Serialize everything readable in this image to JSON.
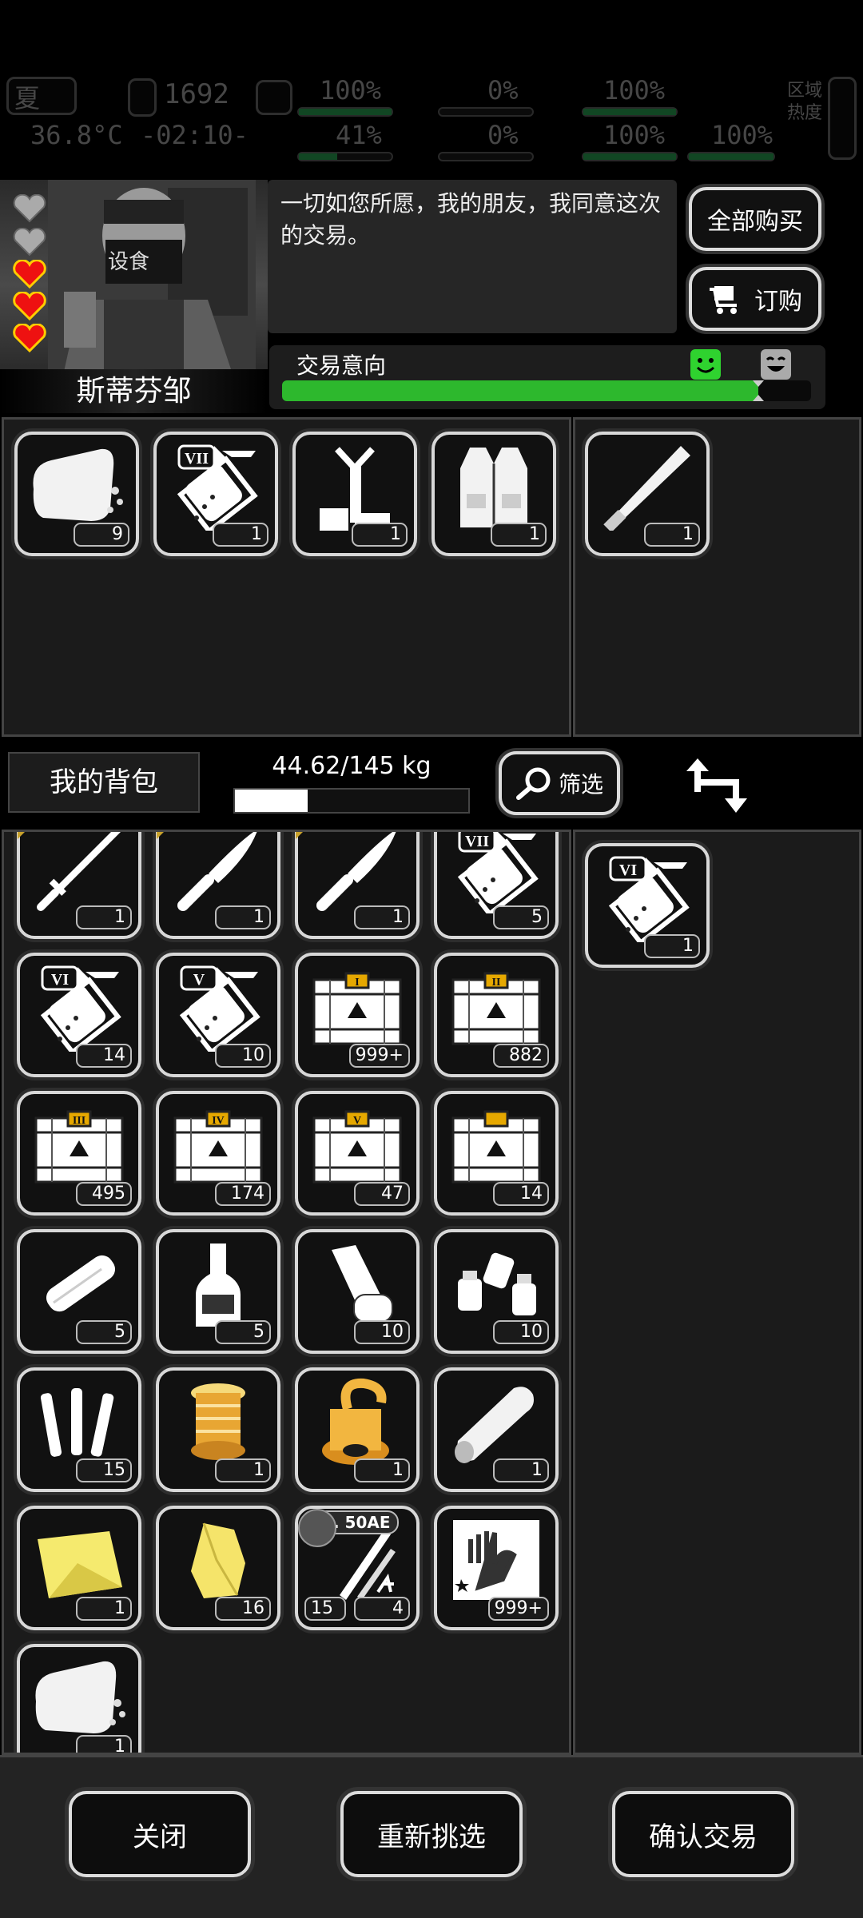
{
  "hud": {
    "season": "夏",
    "body_temp": "36.8°C",
    "day": "1692",
    "clock": "-02:10-",
    "health_pct": "100%",
    "sanity_pct": "41%",
    "blood_loss_pct": "0%",
    "bleed_pct": "0%",
    "stamina_pct": "100%",
    "heart_pct": "100%",
    "water_pct": "100%",
    "area_heat_label": "区域 热度"
  },
  "trader": {
    "name": "斯蒂芬邹",
    "mask_text": "设食",
    "hearts_filled": 3,
    "hearts_total": 5,
    "dialog": "一切如您所愿，我的朋友，我同意这次的交易。",
    "buy_all_label": "全部购买",
    "order_label": "订购",
    "intent_label": "交易意向",
    "intent_level": 0.9
  },
  "trader_inventory": [
    {
      "icon": "bread-icon",
      "count": "9"
    },
    {
      "icon": "potion-vii-icon",
      "count": "1",
      "tier": "VII"
    },
    {
      "icon": "tripod-icon",
      "count": "1"
    },
    {
      "icon": "vest-icon",
      "count": "1"
    },
    {
      "icon": "bat-icon",
      "count": "1"
    }
  ],
  "inventory_bar": {
    "title": "我的背包",
    "weight": "44.62/145 kg",
    "weight_fraction": 0.31,
    "filter_label": "筛选"
  },
  "my_items": [
    {
      "icon": "katana-icon",
      "count": "1",
      "marked": true
    },
    {
      "icon": "knife-icon",
      "count": "1",
      "marked": true
    },
    {
      "icon": "knife-icon",
      "count": "1",
      "marked": true
    },
    {
      "icon": "potion-vii-icon",
      "count": "5",
      "tier": "VII"
    },
    {
      "icon": "potion-vi-icon",
      "count": "14",
      "tier": "VI"
    },
    {
      "icon": "potion-v-icon",
      "count": "10",
      "tier": "V"
    },
    {
      "icon": "crate-i-icon",
      "count": "999+",
      "tier": "I"
    },
    {
      "icon": "crate-ii-icon",
      "count": "882",
      "tier": "II"
    },
    {
      "icon": "crate-iii-icon",
      "count": "495",
      "tier": "III"
    },
    {
      "icon": "crate-iv-icon",
      "count": "174",
      "tier": "IV"
    },
    {
      "icon": "crate-v-icon",
      "count": "47",
      "tier": "V"
    },
    {
      "icon": "crate-special-icon",
      "count": "14"
    },
    {
      "icon": "bandage-roll-icon",
      "count": "5"
    },
    {
      "icon": "bottle-icon",
      "count": "5"
    },
    {
      "icon": "paper-roll-icon",
      "count": "10"
    },
    {
      "icon": "bottles-icon",
      "count": "10"
    },
    {
      "icon": "tubes-icon",
      "count": "15"
    },
    {
      "icon": "gold-spool-icon",
      "count": "1"
    },
    {
      "icon": "gold-fitting-icon",
      "count": "1"
    },
    {
      "icon": "log-icon",
      "count": "1"
    },
    {
      "icon": "gold-cloth-icon",
      "count": "1"
    },
    {
      "icon": "gold-ore-icon",
      "count": "16"
    },
    {
      "icon": "ammo-50ae-icon",
      "count": "4",
      "count2": "15",
      "label": ". 50AE"
    },
    {
      "icon": "zombie-card-icon",
      "count": "999+"
    },
    {
      "icon": "bread-icon",
      "count": "1"
    }
  ],
  "offer_items": [
    {
      "icon": "potion-vi-icon",
      "count": "1",
      "tier": "VI"
    }
  ],
  "bottom": {
    "close_label": "关闭",
    "reselect_label": "重新挑选",
    "confirm_label": "确认交易"
  }
}
